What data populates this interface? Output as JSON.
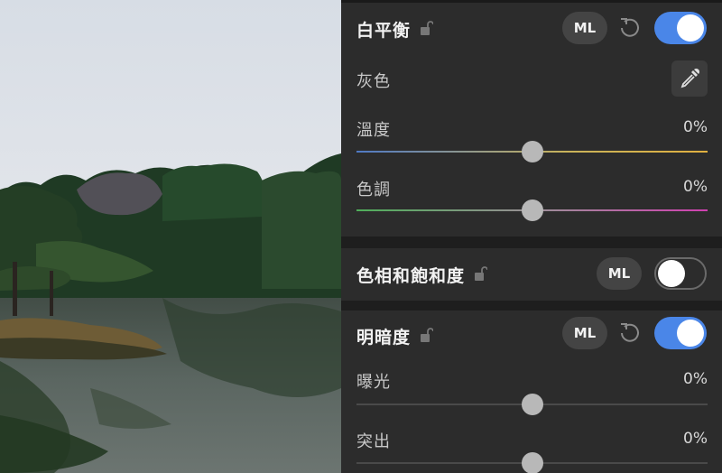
{
  "white_balance": {
    "title": "白平衡",
    "ml_label": "ML",
    "enabled": true,
    "gray_label": "灰色",
    "sliders": [
      {
        "label": "溫度",
        "value": "0%",
        "level": 0.5
      },
      {
        "label": "色調",
        "value": "0%",
        "level": 0.5
      }
    ]
  },
  "hue_saturation": {
    "title": "色相和飽和度",
    "ml_label": "ML",
    "enabled": false
  },
  "brightness": {
    "title": "明暗度",
    "ml_label": "ML",
    "enabled": true,
    "sliders": [
      {
        "label": "曝光",
        "value": "0%",
        "level": 0.5
      },
      {
        "label": "突出",
        "value": "0%",
        "level": 0.5
      }
    ]
  },
  "colors": {
    "accent": "#4a86e8",
    "panel_bg": "#2c2c2c"
  },
  "icons": [
    "lock-icon",
    "reset-icon",
    "eyedropper-icon"
  ]
}
